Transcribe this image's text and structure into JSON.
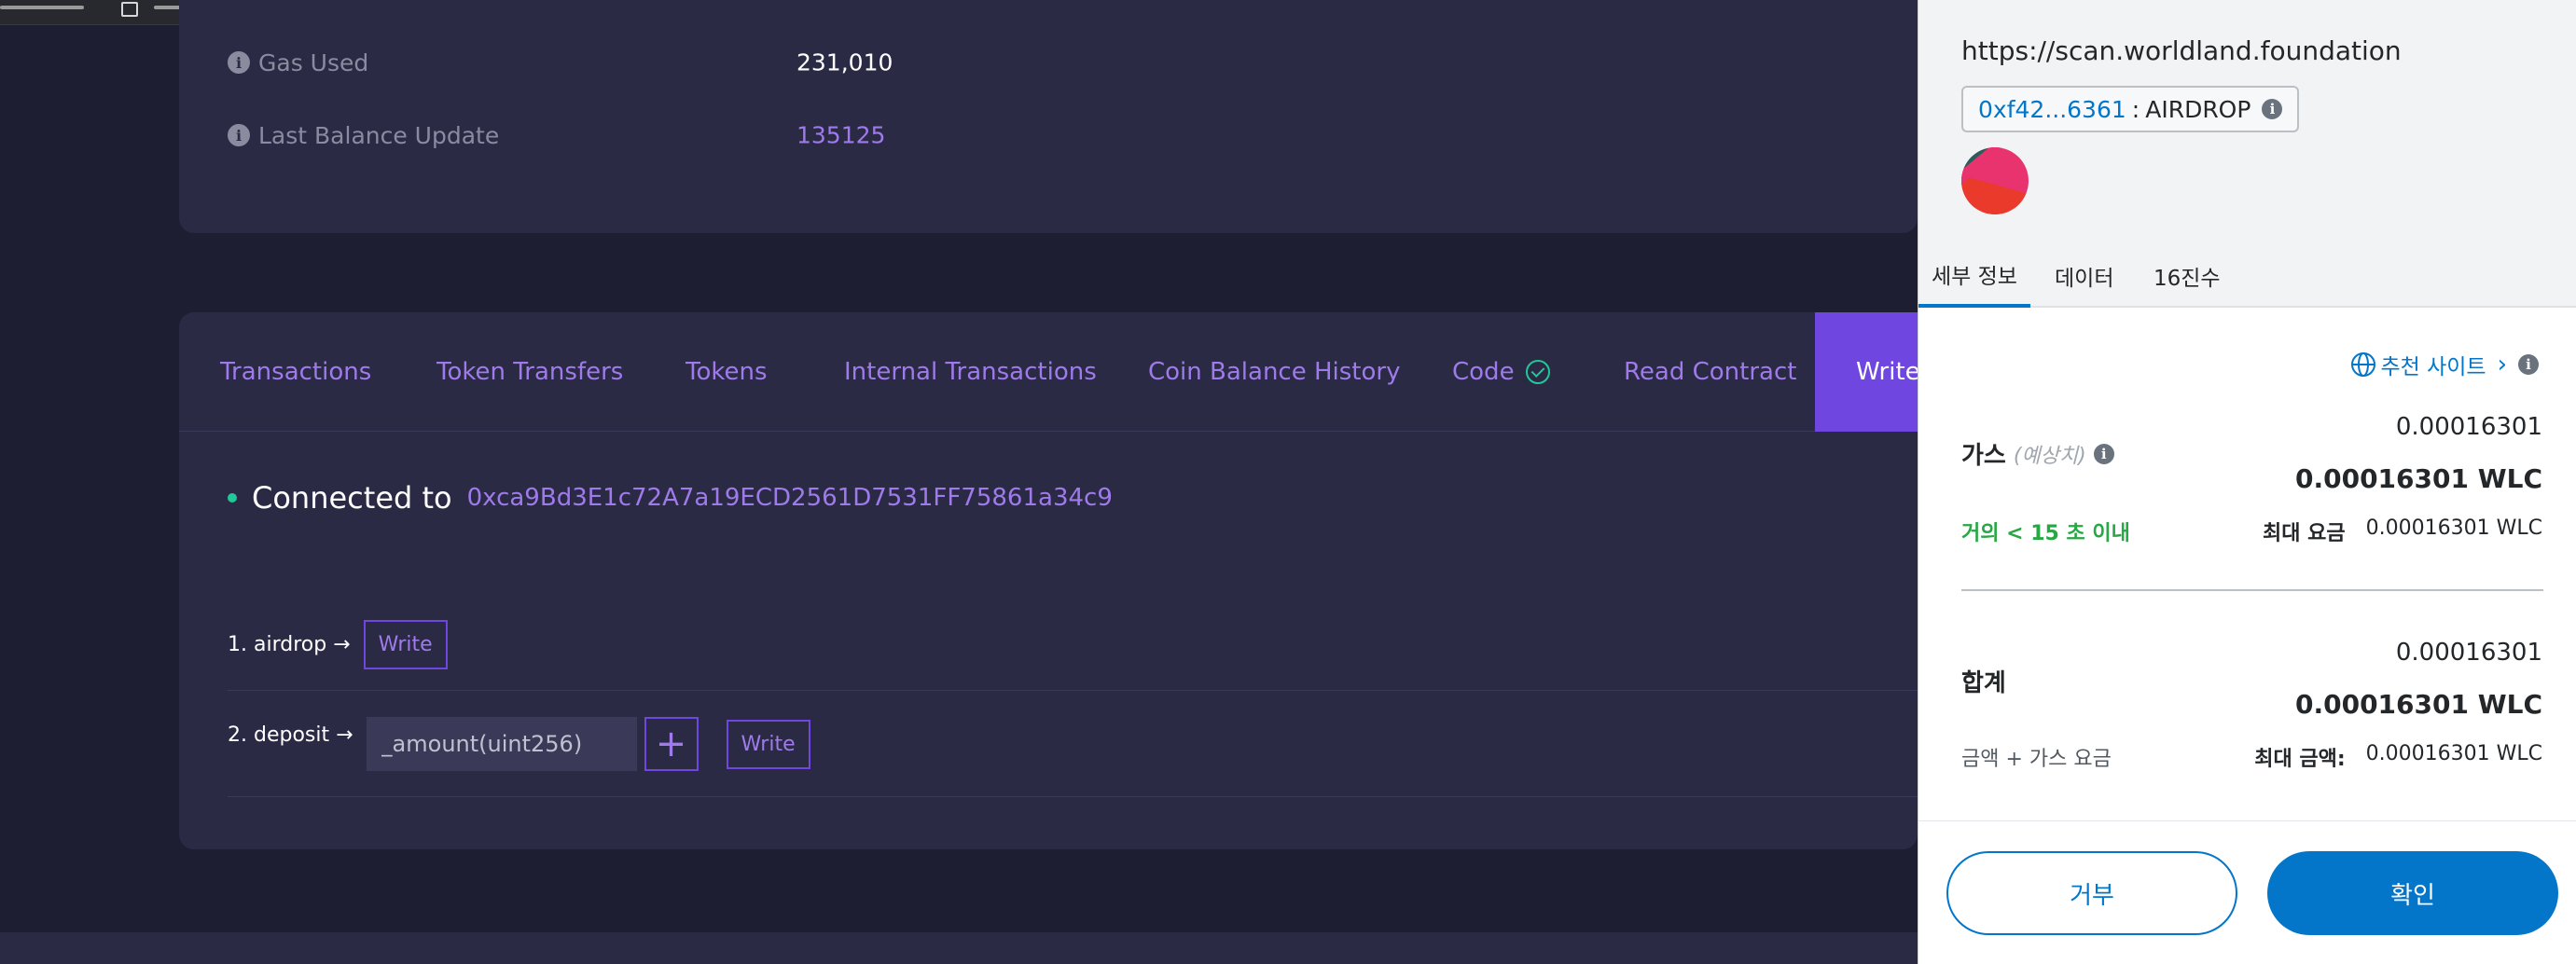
{
  "explorer": {
    "details": {
      "gas_used": {
        "label": "Gas Used",
        "value": "231,010"
      },
      "last_balance_update": {
        "label": "Last Balance Update",
        "value": "135125"
      }
    },
    "tabs": [
      {
        "label": "Transactions"
      },
      {
        "label": "Token Transfers"
      },
      {
        "label": "Tokens"
      },
      {
        "label": "Internal Transactions"
      },
      {
        "label": "Coin Balance History"
      },
      {
        "label": "Code"
      },
      {
        "label": "Read Contract"
      },
      {
        "label": "Write"
      }
    ],
    "connected": {
      "label": "Connected to",
      "address": "0xca9Bd3E1c72A7a19ECD2561D7531FF75861a34c9"
    },
    "methods": [
      {
        "label": "1. airdrop →",
        "button": "Write"
      },
      {
        "label": "2. deposit →",
        "input_placeholder": "_amount(uint256)",
        "plus": "+",
        "button": "Write"
      }
    ],
    "colors": {
      "accent": "#9f7aea",
      "active_tab": "#7046e0",
      "background": "#1e1e33",
      "card": "#2a2a45"
    }
  },
  "wallet": {
    "origin": "https://scan.worldland.foundation",
    "contract": {
      "address": "0xf42...6361",
      "separator": ":",
      "name": "AIRDROP"
    },
    "tabs": [
      {
        "label": "세부 정보"
      },
      {
        "label": "데이터"
      },
      {
        "label": "16진수"
      }
    ],
    "recommended_site": "추천 사이트",
    "gas": {
      "label": "가스",
      "estimate_note": "(예상치)",
      "amount": "0.00016301",
      "amount_bold": "0.00016301 WLC",
      "speed": "거의 < 15 초 이내",
      "max_fee_label": "최대 요금",
      "max_fee_value": "0.00016301 WLC"
    },
    "total": {
      "label": "합계",
      "amount": "0.00016301",
      "amount_bold": "0.00016301 WLC",
      "sub_label": "금액 + 가스 요금",
      "max_amount_label": "최대 금액:",
      "max_amount_value": "0.00016301 WLC"
    },
    "buttons": {
      "reject": "거부",
      "confirm": "확인"
    },
    "colors": {
      "primary": "#0376c9",
      "success": "#28a745"
    }
  }
}
